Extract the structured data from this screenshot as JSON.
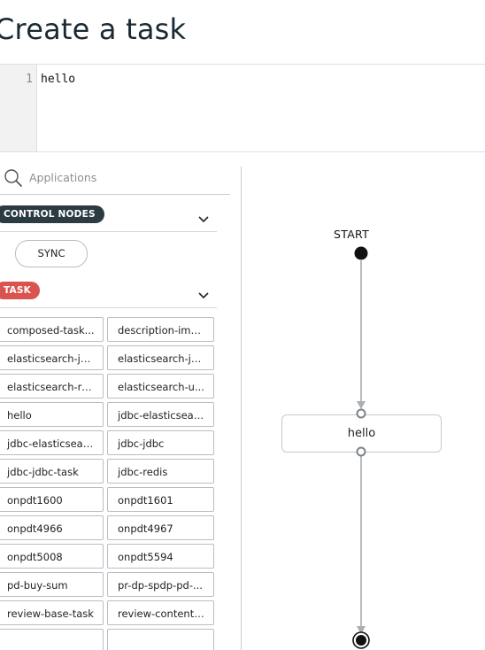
{
  "page": {
    "title": "Create a task"
  },
  "editor": {
    "line_number": "1",
    "code": "hello"
  },
  "palette": {
    "search_placeholder": "Applications",
    "groups": [
      {
        "label": "CONTROL NODES",
        "color": "#2c3a42"
      },
      {
        "label": "TASK",
        "color": "#d9534f"
      }
    ],
    "control_nodes": [
      {
        "label": "SYNC"
      }
    ],
    "tasks": [
      "composed-task...",
      "description-ima...",
      "elasticsearch-jd...",
      "elasticsearch-jd...",
      "elasticsearch-re...",
      "elasticsearch-u...",
      "hello",
      "jdbc-elasticsear...",
      "jdbc-elasticsear...",
      "jdbc-jdbc",
      "jdbc-jdbc-task",
      "jdbc-redis",
      "onpdt1600",
      "onpdt1601",
      "onpdt4966",
      "onpdt4967",
      "onpdt5008",
      "onpdt5594",
      "pd-buy-sum",
      "pr-dp-spdp-pd-...",
      "review-base-task",
      "review-content-..."
    ]
  },
  "canvas": {
    "start_label": "START",
    "nodes": [
      {
        "label": "hello"
      }
    ]
  }
}
